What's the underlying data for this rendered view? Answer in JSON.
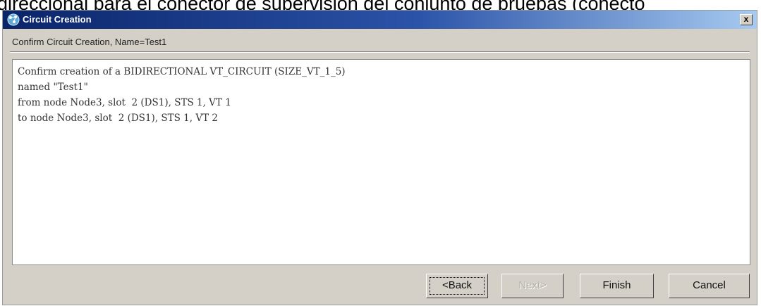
{
  "background_caption": "direccional para el conector de supervisión del conjunto de pruebas (conecto",
  "window": {
    "title": "Circuit Creation",
    "close_label": "x"
  },
  "subtitle": "Confirm Circuit Creation, Name=Test1",
  "message_lines": [
    "Confirm creation of a BIDIRECTIONAL VT_CIRCUIT (SIZE_VT_1_5)",
    "named \"Test1\"",
    "from node Node3, slot  2 (DS1), STS 1, VT 1",
    "to node Node3, slot  2 (DS1), STS 1, VT 2"
  ],
  "buttons": {
    "back": "<Back",
    "next": "Next>",
    "finish": "Finish",
    "cancel": "Cancel"
  },
  "icons": {
    "title": "circuit-icon"
  }
}
